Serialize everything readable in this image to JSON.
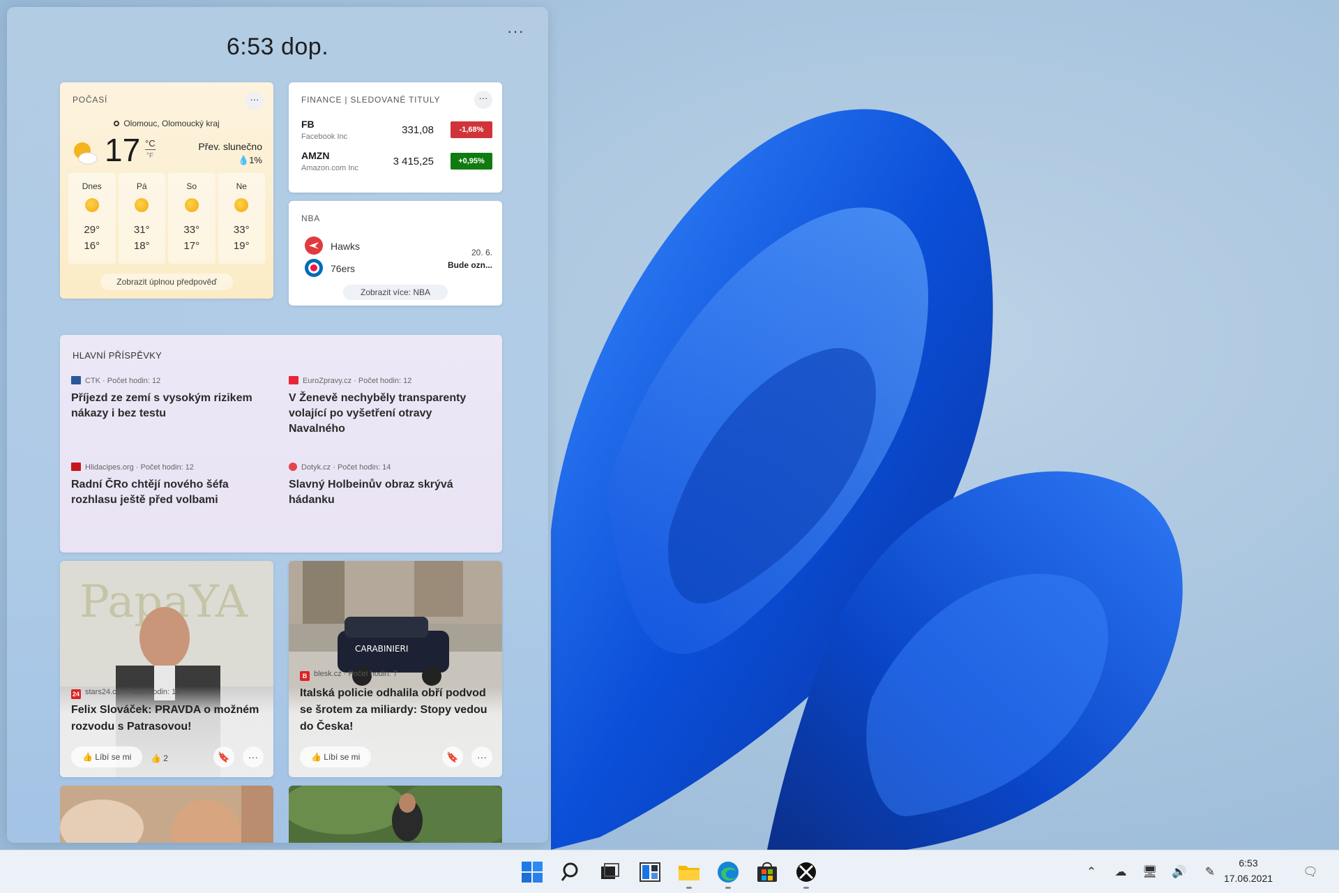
{
  "panel": {
    "time": "6:53 dop.",
    "more": "···"
  },
  "weather": {
    "title": "POČASÍ",
    "more": "···",
    "location": "Olomouc, Olomoucký kraj",
    "temp": "17",
    "unit_c": "°C",
    "unit_f": "°F",
    "condition": "Přev. slunečno",
    "precip": "💧1%",
    "forecast": [
      {
        "day": "Dnes",
        "hi": "29°",
        "lo": "16°"
      },
      {
        "day": "Pá",
        "hi": "31°",
        "lo": "18°"
      },
      {
        "day": "So",
        "hi": "33°",
        "lo": "17°"
      },
      {
        "day": "Ne",
        "hi": "33°",
        "lo": "19°"
      }
    ],
    "forecast_button": "Zobrazit úplnou předpověď"
  },
  "finance": {
    "title": "FINANCE | SLEDOVANÉ TITULY",
    "more": "···",
    "stocks": [
      {
        "symbol": "FB",
        "name": "Facebook Inc",
        "price": "331,08",
        "change": "-1,68%",
        "color": "#d13438"
      },
      {
        "symbol": "AMZN",
        "name": "Amazon.com Inc",
        "price": "3 415,25",
        "change": "+0,95%",
        "color": "#107c10"
      }
    ]
  },
  "nba": {
    "title": "NBA",
    "team1": "Hawks",
    "team2": "76ers",
    "date": "20. 6.",
    "status": "Bude ozn...",
    "button": "Zobrazit více: NBA"
  },
  "top_stories": {
    "title": "HLAVNÍ PŘÍSPĚVKY",
    "items": [
      {
        "source": "CTK · Počet hodin: 12",
        "headline": "Příjezd ze zemí s vysokým rizikem nákazy i bez testu"
      },
      {
        "source": "EuroZpravy.cz · Počet hodin: 12",
        "headline": "V Ženevě nechyběly transparenty volající po vyšetření otravy Navalného"
      },
      {
        "source": "Hlidacipes.org · Počet hodin: 12",
        "headline": "Radní ČRo chtějí nového šéfa rozhlasu ještě před volbami"
      },
      {
        "source": "Dotyk.cz · Počet hodin: 14",
        "headline": "Slavný Holbeinův obraz skrývá hádanku"
      }
    ]
  },
  "news_cards": [
    {
      "source": "stars24.cz · Počet hodin: 19",
      "badge": "24",
      "headline": "Felix Slováček: PRAVDA o možném rozvodu s Patrasovou!",
      "like": "Líbí se mi",
      "likes": "👍 2",
      "img_text": "PapaYA"
    },
    {
      "source": "blesk.cz · Počet hodin: 7",
      "badge": "B",
      "headline": "Italská policie odhalila obří podvod se šrotem za miliardy: Stopy vedou do Česka!",
      "like": "Líbí se mi",
      "likes": "",
      "img_text": "CARABINIERI"
    }
  ],
  "taskbar": {
    "time": "6:53",
    "date": "17.06.2021"
  }
}
